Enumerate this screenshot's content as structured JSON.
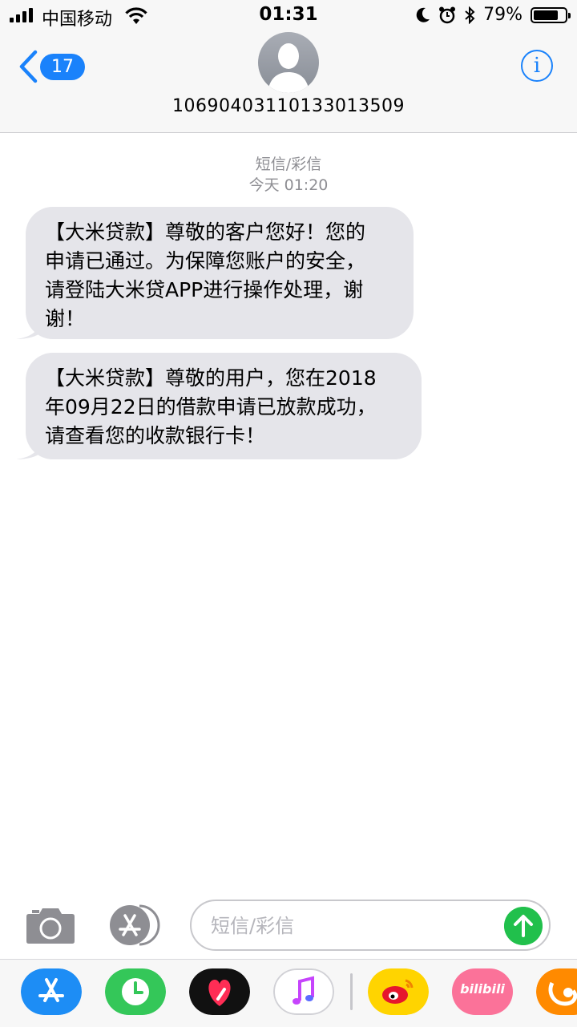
{
  "status_bar": {
    "carrier": "中国移动",
    "time": "01:31",
    "battery_percent": "79%",
    "battery_level": 0.79,
    "signal_bars": 4,
    "icons": [
      "wifi-icon",
      "moon-icon",
      "alarm-icon",
      "bluetooth-icon",
      "battery-icon"
    ]
  },
  "header": {
    "back_badge": "17",
    "contact_number": "10690403110133013509",
    "icons": [
      "back-chevron-icon",
      "contact-avatar-icon",
      "info-icon"
    ]
  },
  "thread": {
    "service_label": "短信/彩信",
    "timestamp": "今天 01:20",
    "messages": [
      {
        "lines": [
          "【大米贷款】尊敬的客户您好！您的",
          "申请已通过。为保障您账户的安全，",
          "请登陆大米贷APP进行操作处理，谢",
          "谢！"
        ]
      },
      {
        "lines": [
          "【大米贷款】尊敬的用户，您在2018",
          "年09月22日的借款申请已放款成功，",
          "请查看您的收款银行卡！"
        ]
      }
    ]
  },
  "composer": {
    "placeholder": "短信/彩信",
    "value": "",
    "icons": [
      "camera-icon",
      "app-store-icon",
      "send-arrow-icon"
    ]
  },
  "app_drawer": {
    "apps": [
      "app-store",
      "activity-clock",
      "digital-touch-heart",
      "music",
      "weibo",
      "bilibili",
      "uc-browser"
    ],
    "bilibili_label": "bilibili"
  },
  "colors": {
    "accent_blue": "#1a82fb",
    "bubble_gray": "#e5e5ea",
    "send_green": "#21c04c",
    "bar_background": "#f7f7f7"
  }
}
